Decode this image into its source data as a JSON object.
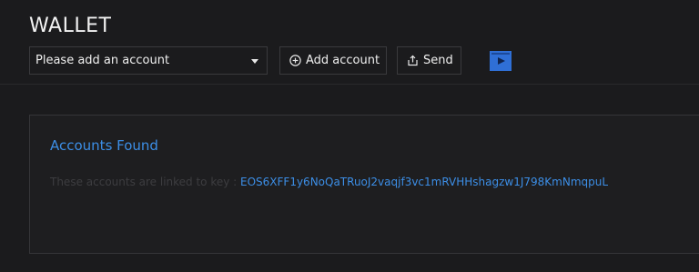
{
  "header": {
    "title": "WALLET"
  },
  "toolbar": {
    "account_select_value": "Please add an account",
    "add_account_label": "Add account",
    "send_label": "Send"
  },
  "accounts_card": {
    "title": "Accounts Found",
    "linked_label": "These accounts are linked to key : ",
    "public_key": "EOS6XFF1y6NoQaTRuoJ2vaqjf3vc1mRVHHshagzw1J798KmNmqpuL"
  },
  "colors": {
    "background": "#1b1b1d",
    "accent": "#3c8ee6",
    "media_icon": "#2f6fd6"
  },
  "icons": {
    "add": "plus-circle-icon",
    "send": "share-icon",
    "media": "play-icon"
  }
}
